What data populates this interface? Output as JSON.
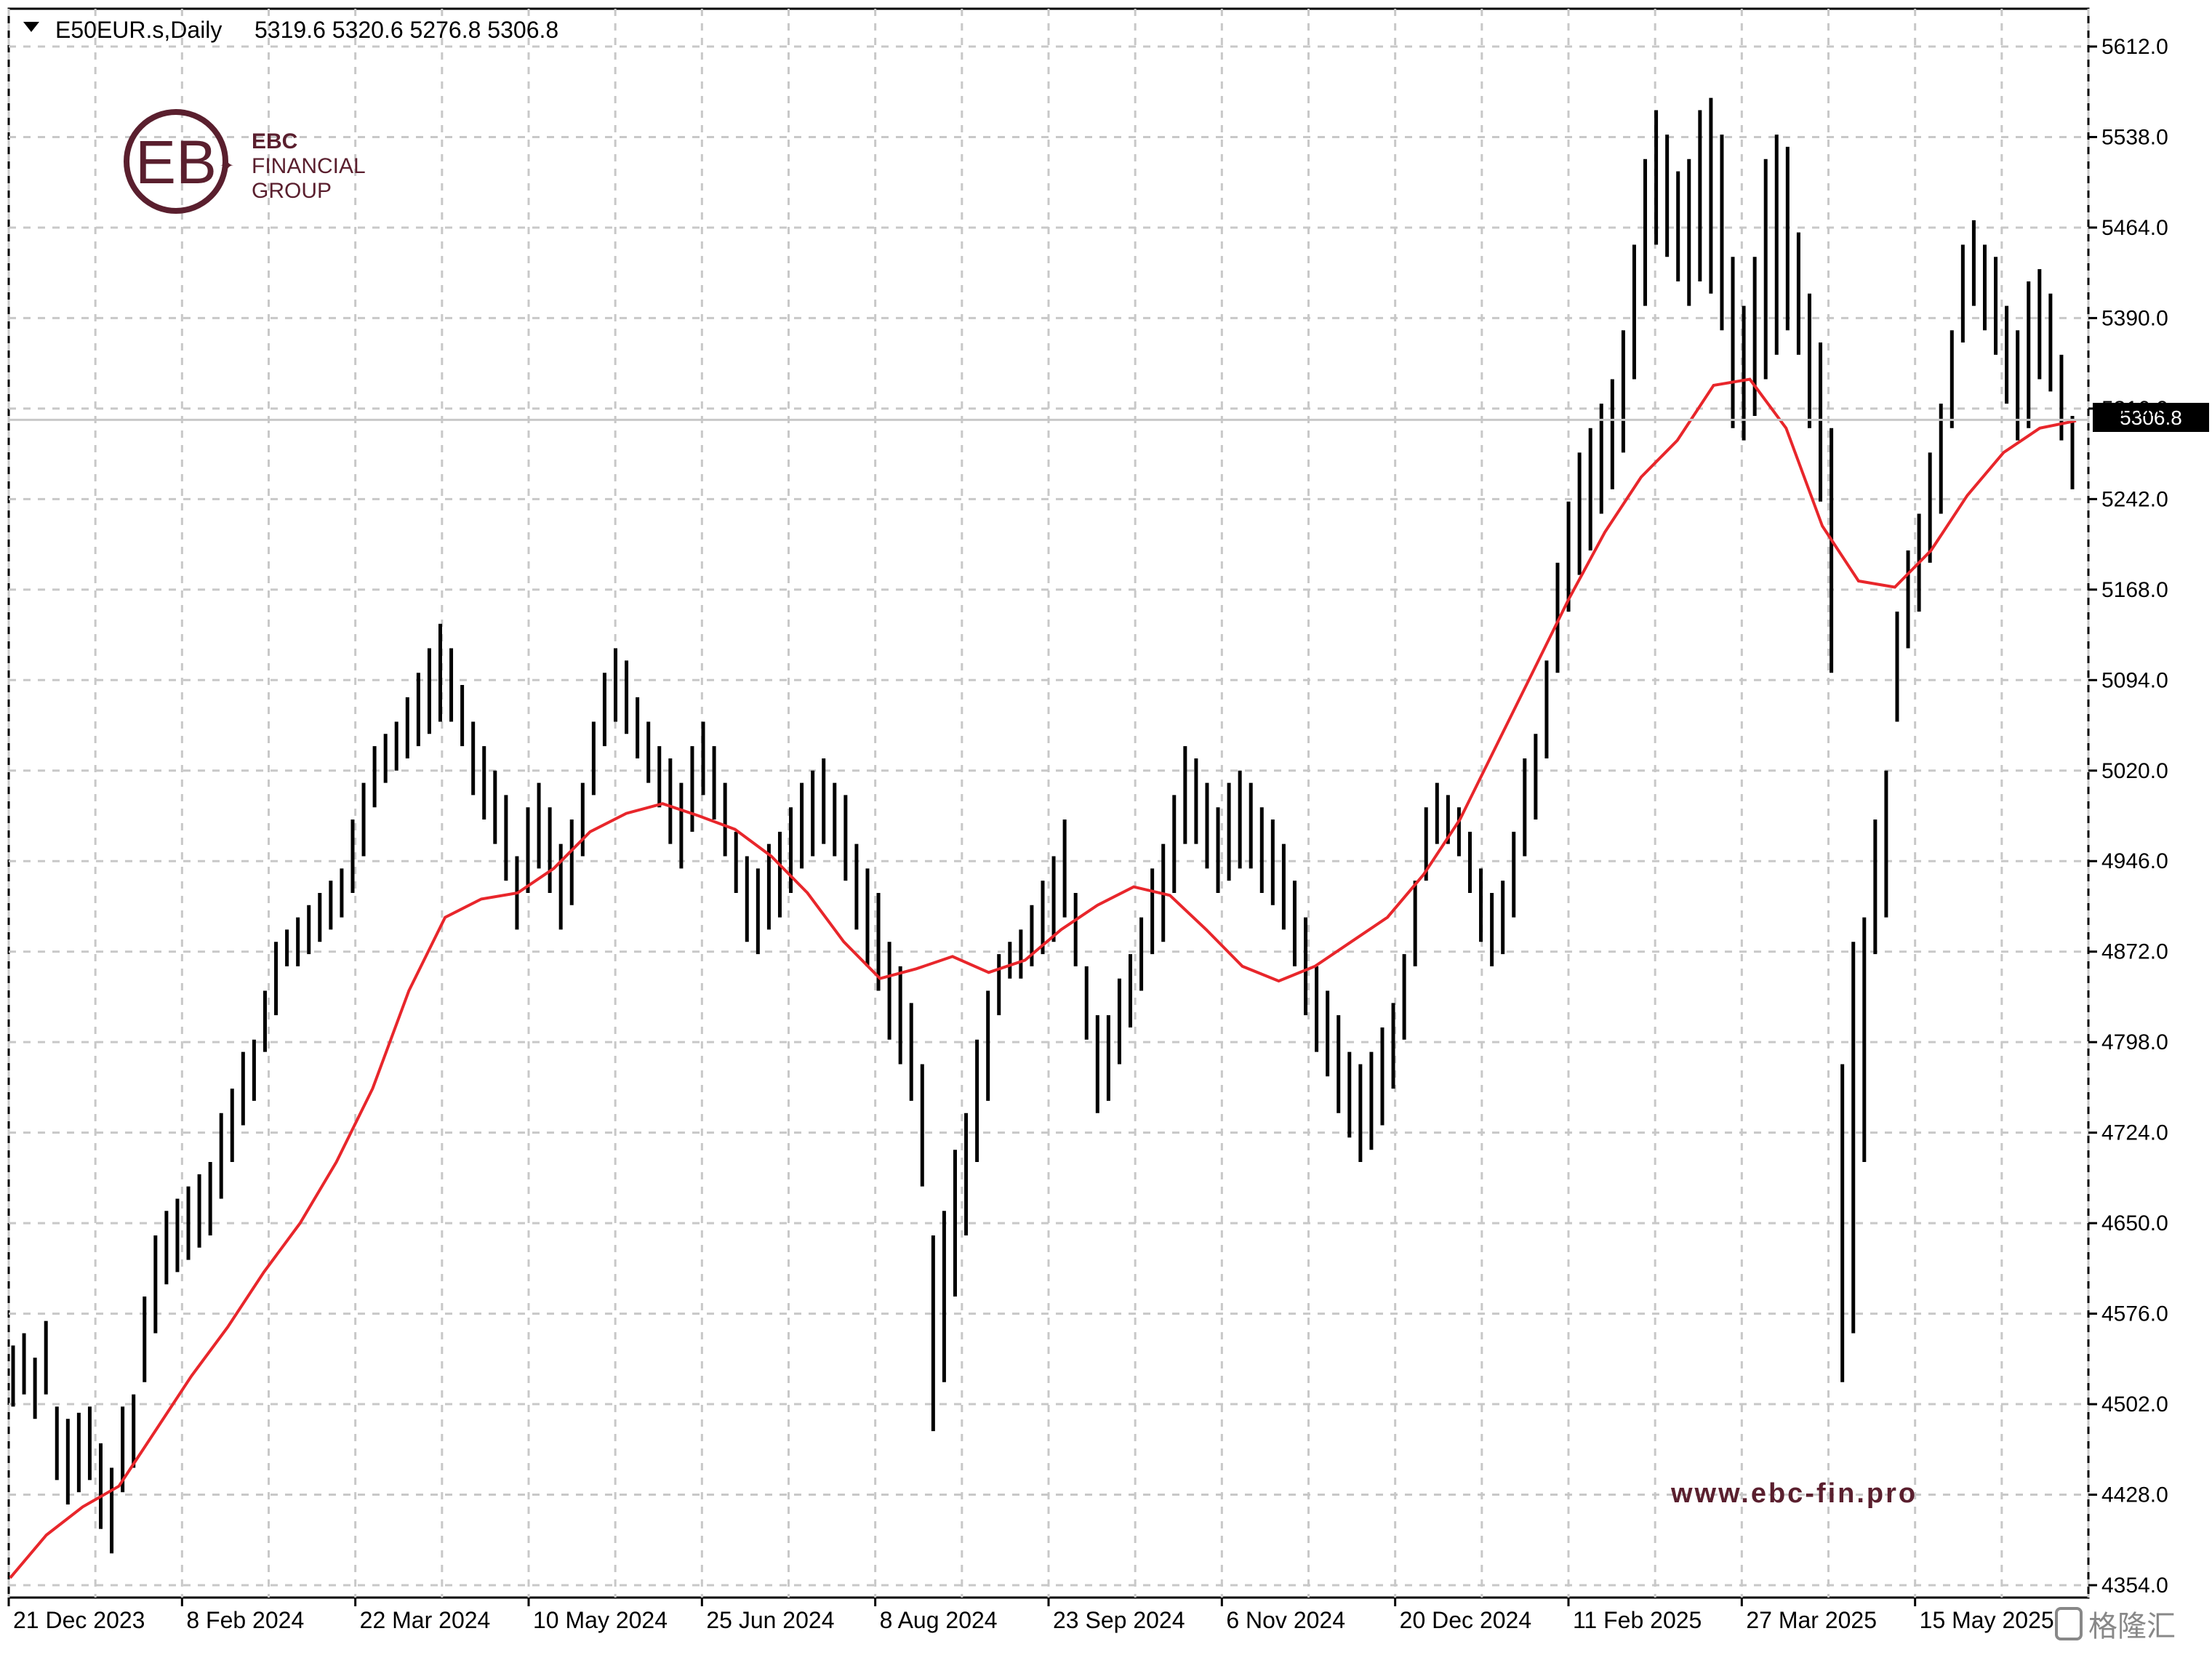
{
  "header": {
    "symbol": "E50EUR.s,Daily",
    "ohlc": "5319.6 5320.6 5276.8 5306.8"
  },
  "logo": {
    "line1": "EBC",
    "line2": "FINANCIAL",
    "line3": "GROUP"
  },
  "watermark": "www.ebc-fin.pro",
  "corner_watermark": "格隆汇",
  "colors": {
    "bars": "#000000",
    "ma_line": "#e8262b",
    "grid": "#c8c8c8",
    "logo": "#5a1f2e",
    "price_label_bg": "#000000"
  },
  "chart_data": {
    "type": "line",
    "title": "E50EUR.s,Daily",
    "ohlc_last": {
      "open": 5319.6,
      "high": 5320.6,
      "low": 5276.8,
      "close": 5306.8
    },
    "current_price_label": "5306.8",
    "grid": true,
    "x_tick_labels": [
      "21 Dec 2023",
      "8 Feb 2024",
      "22 Mar 2024",
      "10 May 2024",
      "25 Jun 2024",
      "8 Aug 2024",
      "23 Sep 2024",
      "6 Nov 2024",
      "20 Dec 2024",
      "11 Feb 2025",
      "27 Mar 2025",
      "15 May 2025"
    ],
    "y_tick_labels": [
      "5612.0",
      "5538.0",
      "5464.0",
      "5390.0",
      "5316.0",
      "5242.0",
      "5168.0",
      "5094.0",
      "5020.0",
      "4946.0",
      "4872.0",
      "4798.0",
      "4724.0",
      "4650.0",
      "4576.0",
      "4502.0",
      "4428.0",
      "4354.0"
    ],
    "ylim": [
      4354,
      5612
    ],
    "series": [
      {
        "kind": "ohlc-range",
        "description_x": "day index",
        "ranges": [
          [
            0,
            4500,
            4550
          ],
          [
            2,
            4510,
            4560
          ],
          [
            4,
            4490,
            4540
          ],
          [
            6,
            4510,
            4570
          ],
          [
            8,
            4440,
            4500
          ],
          [
            10,
            4420,
            4490
          ],
          [
            12,
            4430,
            4495
          ],
          [
            14,
            4440,
            4500
          ],
          [
            16,
            4400,
            4470
          ],
          [
            18,
            4380,
            4450
          ],
          [
            20,
            4430,
            4500
          ],
          [
            22,
            4450,
            4510
          ],
          [
            24,
            4520,
            4590
          ],
          [
            26,
            4560,
            4640
          ],
          [
            28,
            4600,
            4660
          ],
          [
            30,
            4610,
            4670
          ],
          [
            32,
            4620,
            4680
          ],
          [
            34,
            4630,
            4690
          ],
          [
            36,
            4640,
            4700
          ],
          [
            38,
            4670,
            4740
          ],
          [
            40,
            4700,
            4760
          ],
          [
            42,
            4730,
            4790
          ],
          [
            44,
            4750,
            4800
          ],
          [
            46,
            4790,
            4840
          ],
          [
            48,
            4820,
            4880
          ],
          [
            50,
            4860,
            4890
          ],
          [
            52,
            4860,
            4900
          ],
          [
            54,
            4870,
            4910
          ],
          [
            56,
            4880,
            4920
          ],
          [
            58,
            4890,
            4930
          ],
          [
            60,
            4900,
            4940
          ],
          [
            62,
            4920,
            4980
          ],
          [
            64,
            4950,
            5010
          ],
          [
            66,
            4990,
            5040
          ],
          [
            68,
            5010,
            5050
          ],
          [
            70,
            5020,
            5060
          ],
          [
            72,
            5030,
            5080
          ],
          [
            74,
            5040,
            5100
          ],
          [
            76,
            5050,
            5120
          ],
          [
            78,
            5060,
            5140
          ],
          [
            80,
            5060,
            5120
          ],
          [
            82,
            5040,
            5090
          ],
          [
            84,
            5000,
            5060
          ],
          [
            86,
            4980,
            5040
          ],
          [
            88,
            4960,
            5020
          ],
          [
            90,
            4930,
            5000
          ],
          [
            92,
            4890,
            4950
          ],
          [
            94,
            4920,
            4990
          ],
          [
            96,
            4940,
            5010
          ],
          [
            98,
            4920,
            4990
          ],
          [
            100,
            4890,
            4960
          ],
          [
            102,
            4910,
            4980
          ],
          [
            104,
            4950,
            5010
          ],
          [
            106,
            5000,
            5060
          ],
          [
            108,
            5040,
            5100
          ],
          [
            110,
            5060,
            5120
          ],
          [
            112,
            5050,
            5110
          ],
          [
            114,
            5030,
            5080
          ],
          [
            116,
            5010,
            5060
          ],
          [
            118,
            4990,
            5040
          ],
          [
            120,
            4960,
            5030
          ],
          [
            122,
            4940,
            5010
          ],
          [
            124,
            4970,
            5040
          ],
          [
            126,
            5000,
            5060
          ],
          [
            128,
            4980,
            5040
          ],
          [
            130,
            4950,
            5010
          ],
          [
            132,
            4920,
            4970
          ],
          [
            134,
            4880,
            4950
          ],
          [
            136,
            4870,
            4940
          ],
          [
            138,
            4890,
            4960
          ],
          [
            140,
            4900,
            4970
          ],
          [
            142,
            4920,
            4990
          ],
          [
            144,
            4940,
            5010
          ],
          [
            146,
            4950,
            5020
          ],
          [
            148,
            4960,
            5030
          ],
          [
            150,
            4950,
            5010
          ],
          [
            152,
            4930,
            5000
          ],
          [
            154,
            4890,
            4960
          ],
          [
            156,
            4860,
            4940
          ],
          [
            158,
            4840,
            4920
          ],
          [
            160,
            4800,
            4880
          ],
          [
            162,
            4780,
            4860
          ],
          [
            164,
            4750,
            4830
          ],
          [
            166,
            4680,
            4780
          ],
          [
            168,
            4480,
            4640
          ],
          [
            170,
            4520,
            4660
          ],
          [
            172,
            4590,
            4710
          ],
          [
            174,
            4640,
            4740
          ],
          [
            176,
            4700,
            4800
          ],
          [
            178,
            4750,
            4840
          ],
          [
            180,
            4820,
            4870
          ],
          [
            182,
            4850,
            4880
          ],
          [
            184,
            4850,
            4890
          ],
          [
            186,
            4860,
            4910
          ],
          [
            188,
            4870,
            4930
          ],
          [
            190,
            4880,
            4950
          ],
          [
            192,
            4900,
            4980
          ],
          [
            194,
            4860,
            4920
          ],
          [
            196,
            4800,
            4860
          ],
          [
            198,
            4740,
            4820
          ],
          [
            200,
            4750,
            4820
          ],
          [
            202,
            4780,
            4850
          ],
          [
            204,
            4810,
            4870
          ],
          [
            206,
            4840,
            4900
          ],
          [
            208,
            4870,
            4940
          ],
          [
            210,
            4880,
            4960
          ],
          [
            212,
            4920,
            5000
          ],
          [
            214,
            4960,
            5040
          ],
          [
            216,
            4960,
            5030
          ],
          [
            218,
            4940,
            5010
          ],
          [
            220,
            4920,
            4990
          ],
          [
            222,
            4930,
            5010
          ],
          [
            224,
            4940,
            5020
          ],
          [
            226,
            4940,
            5010
          ],
          [
            228,
            4920,
            4990
          ],
          [
            230,
            4910,
            4980
          ],
          [
            232,
            4890,
            4960
          ],
          [
            234,
            4860,
            4930
          ],
          [
            236,
            4820,
            4900
          ],
          [
            238,
            4790,
            4860
          ],
          [
            240,
            4770,
            4840
          ],
          [
            242,
            4740,
            4820
          ],
          [
            244,
            4720,
            4790
          ],
          [
            246,
            4700,
            4780
          ],
          [
            248,
            4710,
            4790
          ],
          [
            250,
            4730,
            4810
          ],
          [
            252,
            4760,
            4830
          ],
          [
            254,
            4800,
            4870
          ],
          [
            256,
            4860,
            4930
          ],
          [
            258,
            4930,
            4990
          ],
          [
            260,
            4960,
            5010
          ],
          [
            262,
            4960,
            5000
          ],
          [
            264,
            4950,
            4990
          ],
          [
            266,
            4920,
            4970
          ],
          [
            268,
            4880,
            4940
          ],
          [
            270,
            4860,
            4920
          ],
          [
            272,
            4870,
            4930
          ],
          [
            274,
            4900,
            4970
          ],
          [
            276,
            4950,
            5030
          ],
          [
            278,
            4980,
            5050
          ],
          [
            280,
            5030,
            5110
          ],
          [
            282,
            5100,
            5190
          ],
          [
            284,
            5150,
            5240
          ],
          [
            286,
            5180,
            5280
          ],
          [
            288,
            5200,
            5300
          ],
          [
            290,
            5230,
            5320
          ],
          [
            292,
            5250,
            5340
          ],
          [
            294,
            5280,
            5380
          ],
          [
            296,
            5340,
            5450
          ],
          [
            298,
            5400,
            5520
          ],
          [
            300,
            5450,
            5560
          ],
          [
            302,
            5440,
            5540
          ],
          [
            304,
            5420,
            5510
          ],
          [
            306,
            5400,
            5520
          ],
          [
            308,
            5420,
            5560
          ],
          [
            310,
            5410,
            5570
          ],
          [
            312,
            5380,
            5540
          ],
          [
            314,
            5300,
            5440
          ],
          [
            316,
            5290,
            5400
          ],
          [
            318,
            5310,
            5440
          ],
          [
            320,
            5340,
            5520
          ],
          [
            322,
            5360,
            5540
          ],
          [
            324,
            5380,
            5530
          ],
          [
            326,
            5360,
            5460
          ],
          [
            328,
            5300,
            5410
          ],
          [
            330,
            5240,
            5370
          ],
          [
            332,
            5100,
            5300
          ],
          [
            334,
            4520,
            4780
          ],
          [
            336,
            4560,
            4880
          ],
          [
            338,
            4700,
            4900
          ],
          [
            340,
            4870,
            4980
          ],
          [
            342,
            4900,
            5020
          ],
          [
            344,
            5060,
            5150
          ],
          [
            346,
            5120,
            5200
          ],
          [
            348,
            5150,
            5230
          ],
          [
            350,
            5190,
            5280
          ],
          [
            352,
            5230,
            5320
          ],
          [
            354,
            5300,
            5380
          ],
          [
            356,
            5370,
            5450
          ],
          [
            358,
            5400,
            5470
          ],
          [
            360,
            5380,
            5450
          ],
          [
            362,
            5360,
            5440
          ],
          [
            364,
            5320,
            5400
          ],
          [
            366,
            5290,
            5380
          ],
          [
            368,
            5300,
            5420
          ],
          [
            370,
            5340,
            5430
          ],
          [
            372,
            5330,
            5410
          ],
          [
            374,
            5290,
            5360
          ],
          [
            376,
            5250,
            5310
          ]
        ]
      },
      {
        "kind": "moving-average",
        "points": [
          [
            0,
            4360
          ],
          [
            8,
            4395
          ],
          [
            16,
            4418
          ],
          [
            24,
            4435
          ],
          [
            32,
            4480
          ],
          [
            40,
            4525
          ],
          [
            48,
            4565
          ],
          [
            56,
            4610
          ],
          [
            64,
            4650
          ],
          [
            72,
            4700
          ],
          [
            80,
            4760
          ],
          [
            88,
            4840
          ],
          [
            96,
            4900
          ],
          [
            104,
            4915
          ],
          [
            112,
            4920
          ],
          [
            120,
            4940
          ],
          [
            128,
            4970
          ],
          [
            136,
            4985
          ],
          [
            144,
            4993
          ],
          [
            152,
            4983
          ],
          [
            160,
            4972
          ],
          [
            168,
            4950
          ],
          [
            176,
            4920
          ],
          [
            184,
            4880
          ],
          [
            192,
            4850
          ],
          [
            200,
            4858
          ],
          [
            208,
            4868
          ],
          [
            216,
            4855
          ],
          [
            224,
            4865
          ],
          [
            232,
            4890
          ],
          [
            240,
            4910
          ],
          [
            248,
            4925
          ],
          [
            256,
            4918
          ],
          [
            264,
            4890
          ],
          [
            272,
            4860
          ],
          [
            280,
            4848
          ],
          [
            288,
            4860
          ],
          [
            296,
            4880
          ],
          [
            304,
            4900
          ],
          [
            312,
            4935
          ],
          [
            320,
            4980
          ],
          [
            328,
            5040
          ],
          [
            336,
            5100
          ],
          [
            344,
            5160
          ],
          [
            352,
            5215
          ],
          [
            360,
            5260
          ],
          [
            368,
            5290
          ],
          [
            376,
            5335
          ],
          [
            384,
            5340
          ],
          [
            392,
            5300
          ],
          [
            400,
            5220
          ],
          [
            408,
            5175
          ],
          [
            416,
            5170
          ],
          [
            424,
            5200
          ],
          [
            432,
            5245
          ],
          [
            440,
            5280
          ],
          [
            448,
            5300
          ],
          [
            456,
            5306
          ]
        ]
      }
    ]
  }
}
